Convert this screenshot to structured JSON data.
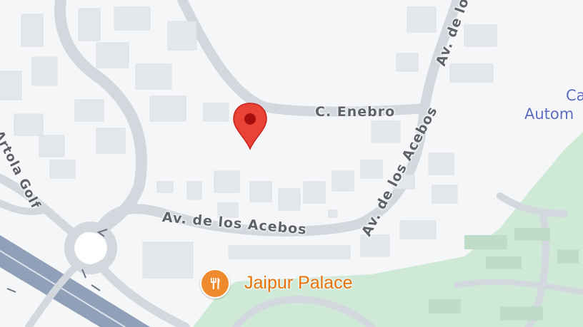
{
  "map": {
    "streets": {
      "c_enebro": "C. Enebro",
      "av_acebos_lower": "Av. de los Acebos",
      "av_acebos_right": "Av. de los Acebos",
      "av_top": "Av. de lo",
      "artola": "Artola Golf"
    },
    "poi": {
      "name": "Jaipur Palace",
      "icon": "restaurant-icon",
      "color": "#e8710a"
    },
    "partial_label": {
      "line1": "Ca",
      "line2": "Autom"
    },
    "marker": {
      "icon": "location-pin-icon",
      "color": "#ea4335"
    },
    "colors": {
      "land": "#f5f6f8",
      "road": "#d4d9e0",
      "building": "#e6e8ec",
      "park": "#cde8d6",
      "highway": "#8c9db5"
    }
  }
}
